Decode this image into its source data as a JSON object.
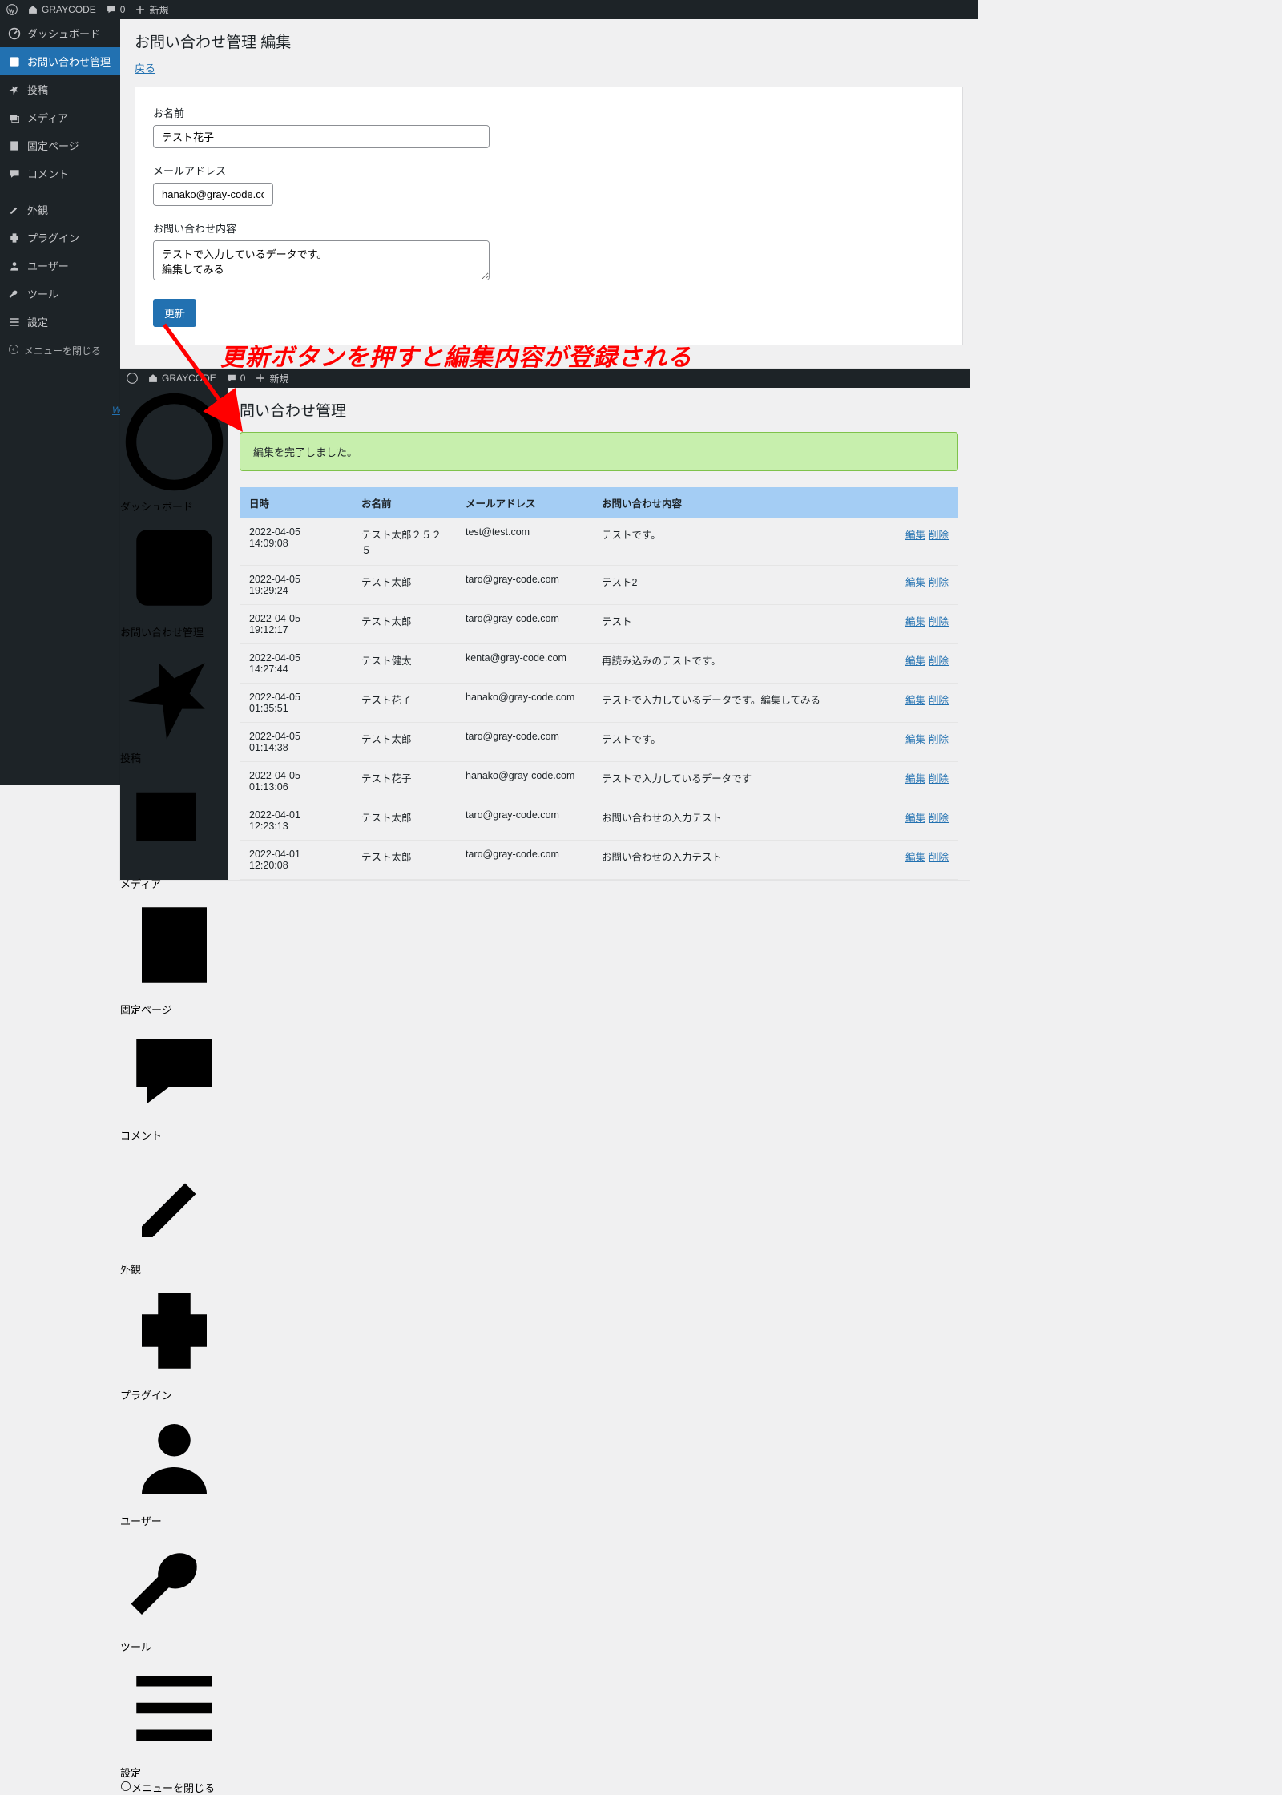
{
  "adminbar": {
    "site": "GRAYCODE",
    "comments": "0",
    "new": "新規"
  },
  "sidebar": {
    "dashboard": "ダッシュボード",
    "contact": "お問い合わせ管理",
    "posts": "投稿",
    "media": "メディア",
    "pages": "固定ページ",
    "comments": "コメント",
    "appearance": "外観",
    "plugins": "プラグイン",
    "users": "ユーザー",
    "tools": "ツール",
    "settings": "設定",
    "collapse": "メニューを閉じる"
  },
  "main1": {
    "title": "お問い合わせ管理 編集",
    "back": "戻る",
    "name_label": "お名前",
    "name_value": "テスト花子",
    "email_label": "メールアドレス",
    "email_value": "hanako@gray-code.com",
    "body_label": "お問い合わせ内容",
    "body_value": "テストで入力しているデータです。\n編集してみる",
    "update": "更新",
    "footer_wo": "Wo"
  },
  "annotation": "更新ボタンを押すと編集内容が登録される",
  "main2": {
    "title": "問い合わせ管理",
    "notice": "編集を完了しました。",
    "headers": {
      "date": "日時",
      "name": "お名前",
      "email": "メールアドレス",
      "body": "お問い合わせ内容"
    },
    "actions": {
      "edit": "編集",
      "delete": "削除"
    },
    "rows": [
      {
        "date": "2022-04-05 14:09:08",
        "name": "テスト太郎２５２５",
        "email": "test@test.com",
        "body": "テストです。"
      },
      {
        "date": "2022-04-05 19:29:24",
        "name": "テスト太郎",
        "email": "taro@gray-code.com",
        "body": "テスト2"
      },
      {
        "date": "2022-04-05 19:12:17",
        "name": "テスト太郎",
        "email": "taro@gray-code.com",
        "body": "テスト"
      },
      {
        "date": "2022-04-05 14:27:44",
        "name": "テスト健太",
        "email": "kenta@gray-code.com",
        "body": "再読み込みのテストです。"
      },
      {
        "date": "2022-04-05 01:35:51",
        "name": "テスト花子",
        "email": "hanako@gray-code.com",
        "body": "テストで入力しているデータです。編集してみる"
      },
      {
        "date": "2022-04-05 01:14:38",
        "name": "テスト太郎",
        "email": "taro@gray-code.com",
        "body": "テストです。"
      },
      {
        "date": "2022-04-05 01:13:06",
        "name": "テスト花子",
        "email": "hanako@gray-code.com",
        "body": "テストで入力しているデータです"
      },
      {
        "date": "2022-04-01 12:23:13",
        "name": "テスト太郎",
        "email": "taro@gray-code.com",
        "body": "お問い合わせの入力テスト"
      },
      {
        "date": "2022-04-01 12:20:08",
        "name": "テスト太郎",
        "email": "taro@gray-code.com",
        "body": "お問い合わせの入力テスト"
      }
    ]
  }
}
